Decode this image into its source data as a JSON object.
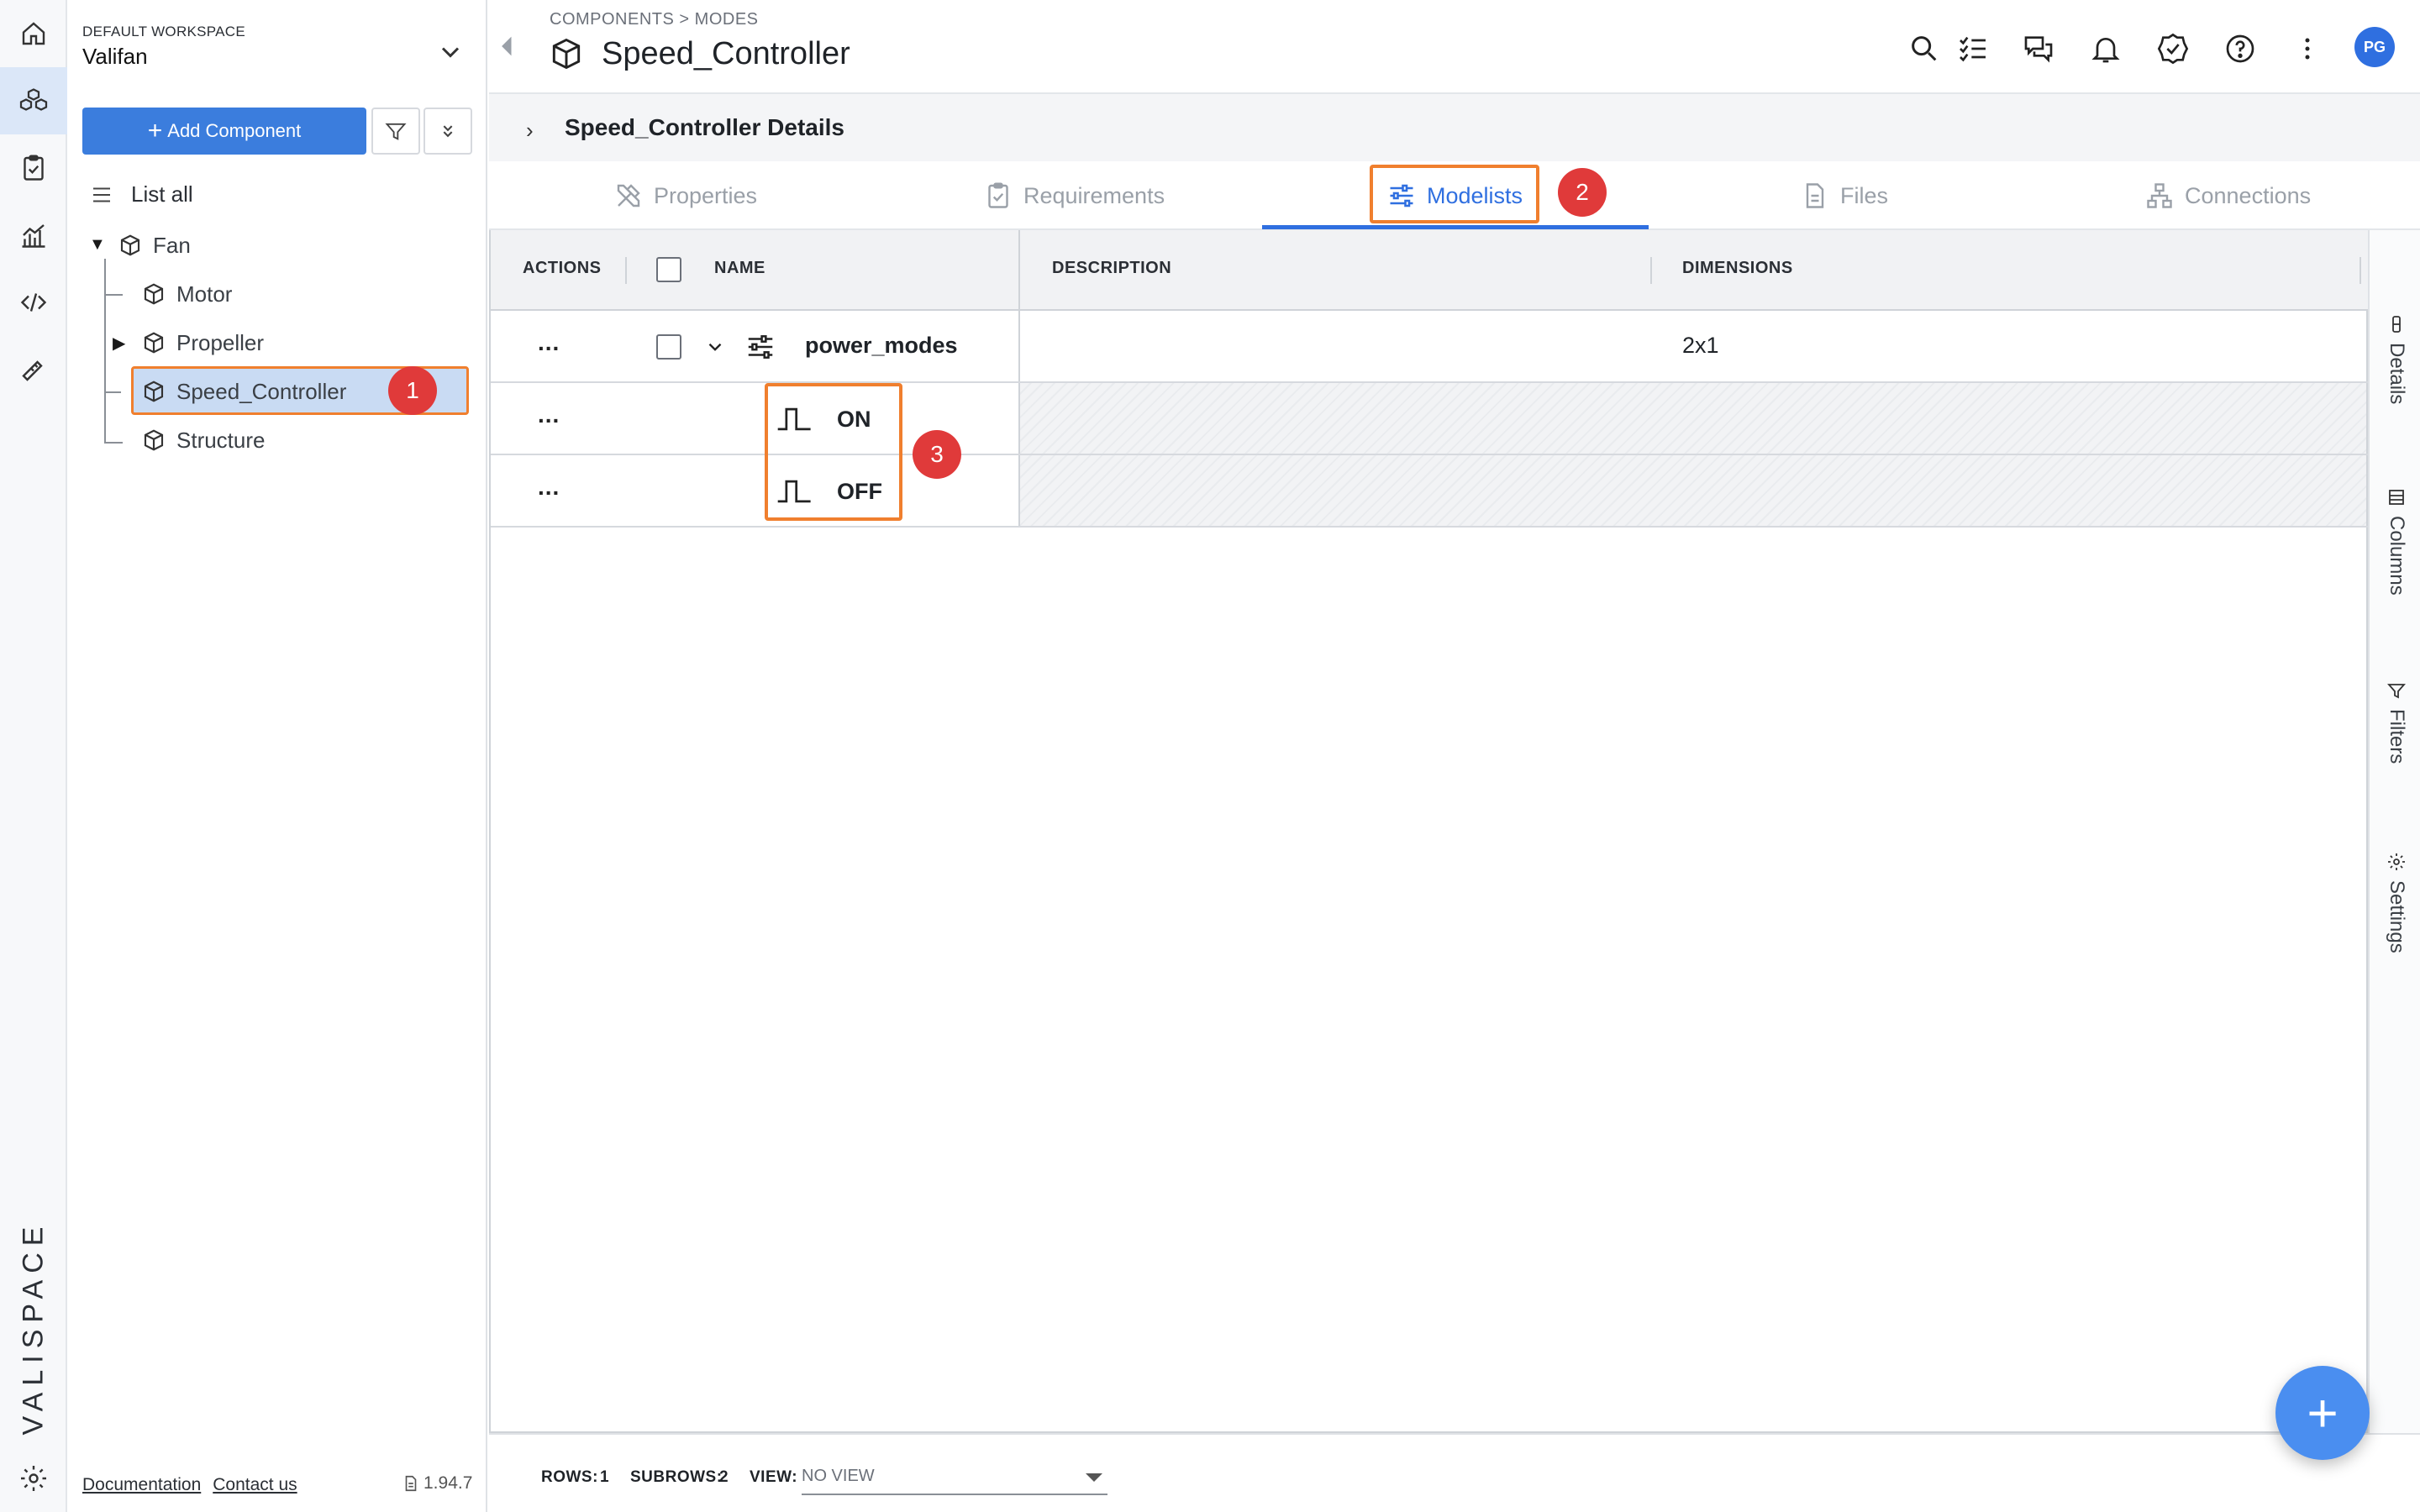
{
  "workspace": {
    "label": "DEFAULT WORKSPACE",
    "name": "Valifan"
  },
  "sidebar_actions": {
    "add_component": "Add Component"
  },
  "tree": {
    "list_all": "List all",
    "items": [
      {
        "label": "Fan"
      },
      {
        "label": "Motor"
      },
      {
        "label": "Propeller"
      },
      {
        "label": "Speed_Controller"
      },
      {
        "label": "Structure"
      }
    ]
  },
  "brand": "VALISPACE",
  "footer": {
    "documentation": "Documentation",
    "contact": "Contact us",
    "version": "1.94.7"
  },
  "header": {
    "breadcrumb": [
      "COMPONENTS",
      "MODES"
    ],
    "title": "Speed_Controller",
    "avatar": "PG"
  },
  "details_bar": {
    "label": "Speed_Controller Details"
  },
  "tabs": [
    {
      "label": "Properties",
      "icon": "tools-icon"
    },
    {
      "label": "Requirements",
      "icon": "clipboard-check-icon"
    },
    {
      "label": "Modelists",
      "icon": "sliders-icon",
      "active": true
    },
    {
      "label": "Files",
      "icon": "file-icon"
    },
    {
      "label": "Connections",
      "icon": "network-icon"
    }
  ],
  "table": {
    "columns": [
      "ACTIONS",
      "NAME",
      "DESCRIPTION",
      "DIMENSIONS"
    ],
    "rows": [
      {
        "actions": "...",
        "name": "power_modes",
        "description": "",
        "dimensions": "2x1"
      },
      {
        "actions": "...",
        "name": "ON"
      },
      {
        "actions": "...",
        "name": "OFF"
      }
    ]
  },
  "side_panel": [
    "Details",
    "Columns",
    "Filters",
    "Settings"
  ],
  "grid_footer": {
    "rows_label": "ROWS:",
    "rows_value": "1",
    "subrows_label": "SUBROWS:",
    "subrows_value": "2",
    "view_label": "VIEW:",
    "view_value": "NO VIEW"
  },
  "annotations": [
    "1",
    "2",
    "3"
  ],
  "colors": {
    "accent": "#2f6fe0",
    "highlight": "#f07f2e",
    "badge": "#e03a3a"
  }
}
